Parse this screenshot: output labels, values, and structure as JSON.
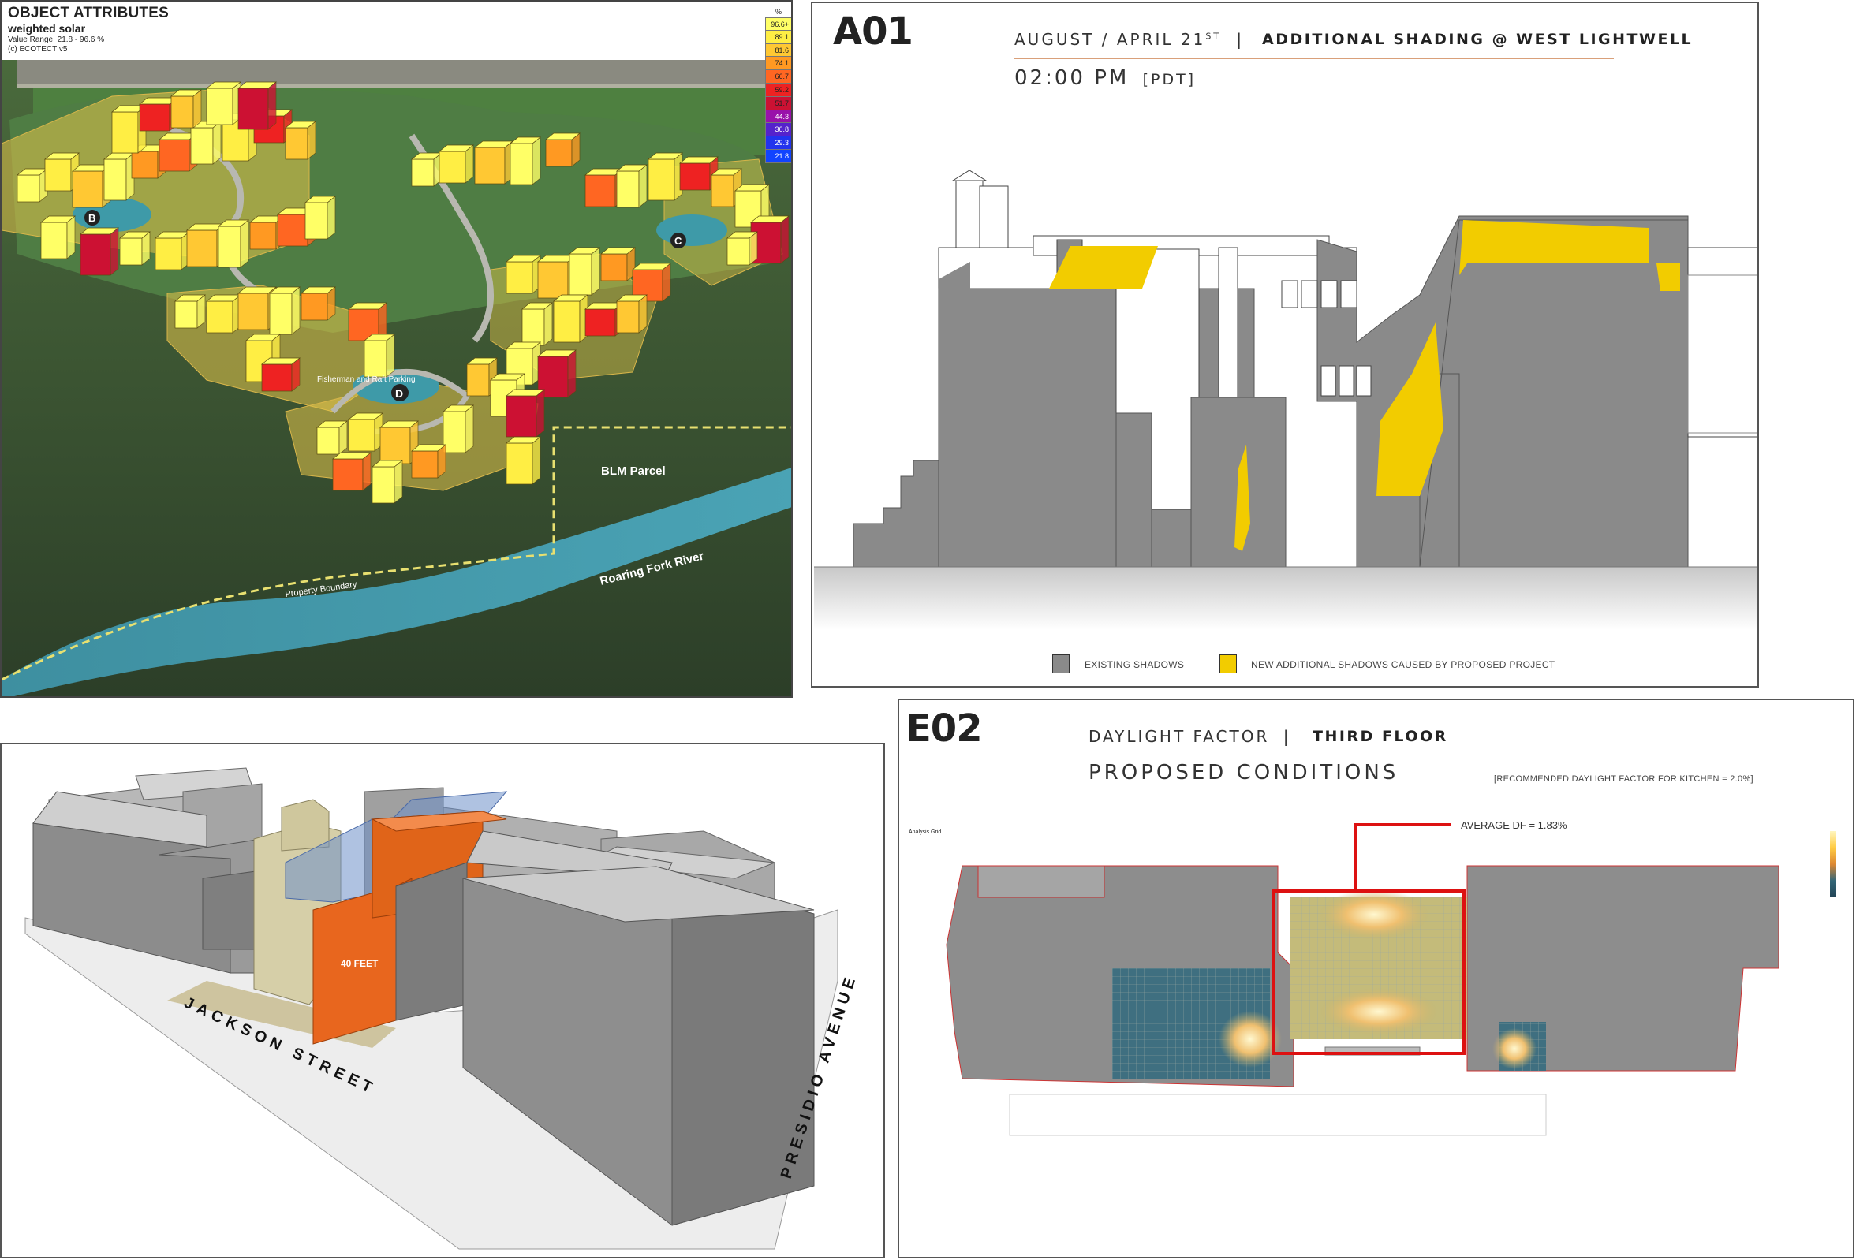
{
  "solar": {
    "title": "OBJECT ATTRIBUTES",
    "subtitle": "weighted solar",
    "value_range": "Value Range: 21.8 - 96.6 %",
    "credit": "(c) ECOTECT v5",
    "legend_unit": "%",
    "legend": [
      {
        "label": "96.6+",
        "color": "#ffff66"
      },
      {
        "label": "89.1",
        "color": "#ffee44"
      },
      {
        "label": "81.6",
        "color": "#ffc833"
      },
      {
        "label": "74.1",
        "color": "#ff9922"
      },
      {
        "label": "66.7",
        "color": "#ff6622"
      },
      {
        "label": "59.2",
        "color": "#ee2222"
      },
      {
        "label": "51.7",
        "color": "#cc1133"
      },
      {
        "label": "44.3",
        "color": "#9911aa"
      },
      {
        "label": "36.8",
        "color": "#5522cc"
      },
      {
        "label": "29.3",
        "color": "#2233ee"
      },
      {
        "label": "21.8",
        "color": "#1144ff"
      }
    ],
    "map_labels": {
      "parcel": "BLM Parcel",
      "river": "Roaring Fork River",
      "boundary": "Property Boundary",
      "pod_b": "B",
      "pod_c": "C",
      "pod_d": "D",
      "parking": "Fisherman and Raft Parking"
    }
  },
  "shadow_sheet": {
    "id": "A01",
    "date_line": "AUGUST / APRIL 21",
    "date_sup": "ST",
    "separator": "|",
    "subject": "ADDITIONAL SHADING @ WEST LIGHTWELL",
    "time": "02:00 PM",
    "tz": "[PDT]",
    "legend_existing": "EXISTING SHADOWS",
    "legend_new": "NEW ADDITIONAL SHADOWS CAUSED BY PROPOSED PROJECT",
    "colors": {
      "existing": "#8a8a8a",
      "new": "#f2cc00"
    }
  },
  "massing": {
    "street_1": "JACKSON STREET",
    "street_2": "PRESIDIO AVENUE",
    "height_label": "40 FEET",
    "colors": {
      "proposed": "#e8661e",
      "existing": "#8c8c8c"
    }
  },
  "daylight_sheet": {
    "id": "E02",
    "metric": "DAYLIGHT FACTOR",
    "separator": "|",
    "floor": "THIRD FLOOR",
    "condition": "PROPOSED CONDITIONS",
    "recommendation": "[RECOMMENDED DAYLIGHT FACTOR FOR KITCHEN = 2.0%]",
    "average": "AVERAGE DF = 1.83%",
    "grid_caption": "Analysis Grid",
    "highlight_color": "#dd1111"
  }
}
